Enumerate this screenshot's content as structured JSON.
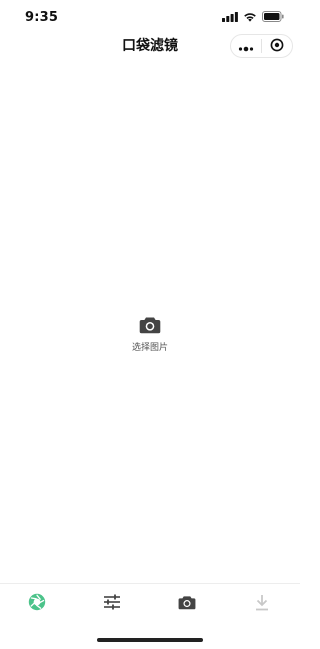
{
  "status_bar": {
    "time": "9:35",
    "icons": [
      "signal-icon",
      "wifi-icon",
      "battery-icon"
    ]
  },
  "nav": {
    "title": "口袋滤镜",
    "capsule": {
      "more_icon": "more-dots-icon",
      "close_icon": "target-circle-icon"
    }
  },
  "main": {
    "picker_icon": "camera-icon",
    "picker_label": "选择图片"
  },
  "tabbar": {
    "tabs": [
      {
        "icon": "aperture-icon",
        "active": true
      },
      {
        "icon": "sliders-icon",
        "active": false
      },
      {
        "icon": "camera-icon",
        "active": false
      },
      {
        "icon": "download-icon",
        "active": false
      }
    ]
  },
  "colors": {
    "accent": "#4cc38a",
    "icon_dark": "#444444",
    "icon_disabled": "#c8c8c8",
    "text_secondary": "#555555"
  }
}
